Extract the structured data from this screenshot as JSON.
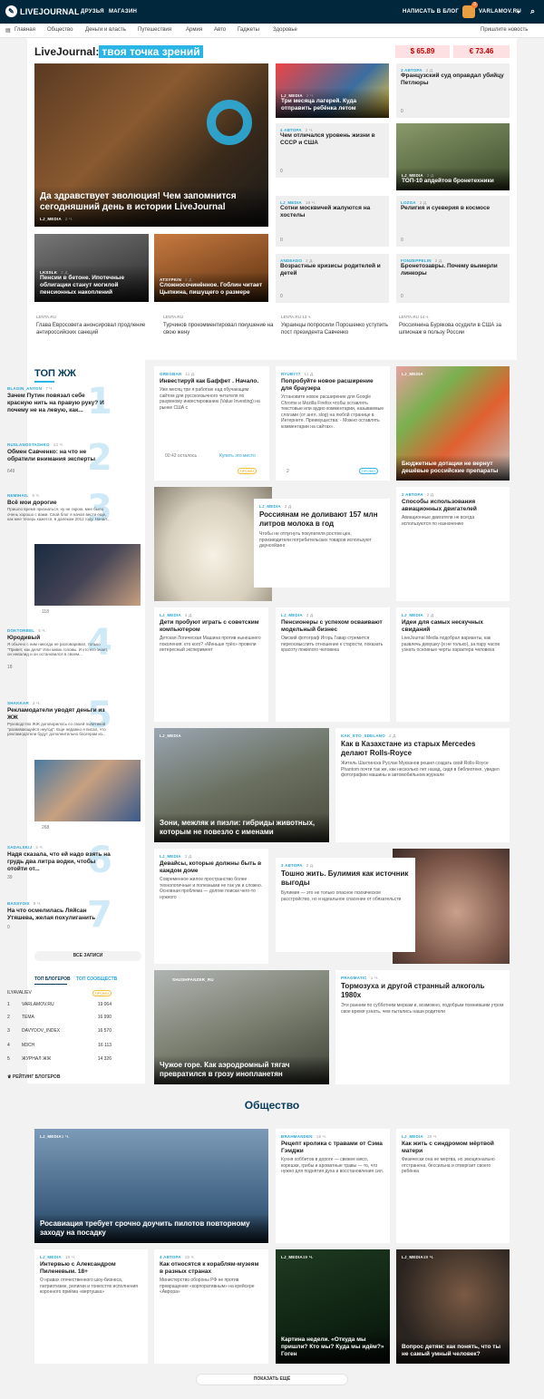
{
  "header": {
    "logo": "LIVEJOURNAL",
    "nav": [
      "ДРУЗЬЯ",
      "МАГАЗИН"
    ],
    "write": "НАПИСАТЬ В БЛОГ",
    "user": "VARLAMOV.RU",
    "badge": "3"
  },
  "subnav": {
    "items": [
      "Главная",
      "Общество",
      "Деньги и власть",
      "Путешествия",
      "Армия",
      "Авто",
      "Гаджеты",
      "Здоровье"
    ],
    "suggest": "Пришлите новость"
  },
  "hero": {
    "title_a": "LiveJournal:",
    "title_b": "твоя точка зрений",
    "usd": "$ 65.89",
    "eur": "€ 73.46",
    "main": {
      "title": "Да здравствует эволюция! Чем запомнится сегодняшний день в истории LiveJournal",
      "author": "LJ_MEDIA",
      "time": "2 ч.",
      "c": "0"
    },
    "small": [
      {
        "author": "LKSSLK",
        "time": "2 д.",
        "title": "Пенсии в бетоне. Ипотечные облигации станут могилой пенсионных накоплений",
        "c": "0"
      },
      {
        "author": "ATSYPKIN",
        "time": "2 д.",
        "title": "Сложносочинённое. Гоблин читает Цыпкина, пишущего о размере",
        "c": "0"
      }
    ],
    "grid": [
      {
        "author": "LJ_MEDIA",
        "time": "2 ч.",
        "title": "Три месяца лагерей. Куда отправить ребёнка летом",
        "c": "0"
      },
      {
        "author": "3 АВТОРА",
        "time": "2 д.",
        "title": "Французский суд оправдал убийцу Петлюры",
        "c": "0"
      },
      {
        "author": "4 АВТОРА",
        "time": "2 ч.",
        "title": "Чем отличался уровень жизни в СССР и США",
        "c": "0"
      },
      {
        "author": "LJ_MEDIA",
        "time": "2 д.",
        "title": "ТОП-10 апдейтов бронетехники",
        "c": "0"
      },
      {
        "author": "LJ_MEDIA",
        "time": "19 ч.",
        "title": "Сотни москвичей жалуются на хостелы",
        "c": "0"
      },
      {
        "author": "LOZGA",
        "time": "2 д.",
        "title": "Религия и суеверия в космосе",
        "c": "0"
      },
      {
        "author": "ANDEADO",
        "time": "2 д.",
        "title": "Возрастные кризисы родителей и детей",
        "c": "0"
      },
      {
        "author": "FONZEPPELIN",
        "time": "2 д.",
        "title": "Бронетозавры. Почему вымерли линкоры",
        "c": "0"
      }
    ],
    "news": [
      {
        "src": "LENTA.RU",
        "t": "",
        "title": "Глава Евросовета анонсировал продление антироссийских санкций"
      },
      {
        "src": "LENTA.RU",
        "t": "",
        "title": "Турчинов прокомментировал покушение на свою жену"
      },
      {
        "src": "LENTA.RU",
        "t": "13 ч.",
        "title": "Украинцы попросили Порошенко уступить пост президента Савченко"
      },
      {
        "src": "LENTA.RU",
        "t": "14 ч.",
        "title": "Россиянина Бурякова осудили в США за шпионаж в пользу России"
      }
    ]
  },
  "top": {
    "title": "ТОП ЖЖ",
    "items": [
      {
        "n": "1",
        "author": "BLAGIN_ANTON",
        "time": "7 ч.",
        "title": "Зачем Путин повязал себе красную нить на правую руку? И почему не на левую, как...",
        "c": "0"
      },
      {
        "n": "2",
        "author": "RUSLANOSTASHKO",
        "time": "13 ч.",
        "title": "Обмен Савченко: на что не обратили внимания эксперты",
        "c": "649"
      },
      {
        "n": "3",
        "author": "NEMIHAIL",
        "time": "9 ч.",
        "title": "Всё мои дорогие",
        "text": "Пришло время признаться, ну не скрою, мне было очень хорошо с вами. Свой блог я начал вести еще, как мне теперь кажется, в далеком 2012 году. Начал...",
        "c": "118"
      },
      {
        "n": "4",
        "author": "DOKTORBEL",
        "time": "5 ч.",
        "title": "Юродивый",
        "text": "Я обычно с ним никогда не разговаривал, только \"Привет, как дела\" Или кивок головы. И кто его знает, он инвалид и он остановился в своем...",
        "c": "18"
      },
      {
        "n": "5",
        "author": "SHAKKAR",
        "time": "3 ч.",
        "title": "Рекламодатели уводят деньги из ЖЖ",
        "text": "Руководство ЖЖ договорилось со своей политикой \"развивающейся неугод\". Еще недавно я писал, что рекламодатели будут дополнительно блогерам из...",
        "c": "268"
      },
      {
        "n": "6",
        "author": "SADALSKIJ",
        "time": "2 ч.",
        "title": "Надя сказала, что ей надо взять на грудь два литра водки, чтобы отойти от...",
        "c": "39"
      },
      {
        "n": "7",
        "author": "BASSYOIX",
        "time": "8 ч.",
        "title": "На что осмелилась Ляйсан Утяшева, желая похулиганить",
        "c": "0"
      }
    ],
    "all": "ВСЕ ЗАПИСИ",
    "tabs": [
      "ТОП БЛОГЕРОВ",
      "ТОП СООБЩЕСТВ"
    ],
    "me": "ILYAVALIEV",
    "promo": "ПРОМО",
    "bloggers": [
      {
        "n": "1",
        "name": "VARLAMOV.RU",
        "v": "19 064"
      },
      {
        "n": "2",
        "name": "TEMA",
        "v": "16 990"
      },
      {
        "n": "3",
        "name": "DAVYDOV_INDEX",
        "v": "16 570"
      },
      {
        "n": "4",
        "name": "M3CH",
        "v": "16 113"
      },
      {
        "n": "5",
        "name": "ЖУРНАЛ ЖЖ",
        "v": "14 326"
      }
    ],
    "rating": "РЕЙТИНГ БЛОГЕРОВ"
  },
  "feed": [
    {
      "author": "GREGBAR",
      "time": "11 д.",
      "title": "Инвестируй как Баффет . Начало.",
      "text": "Уже месяц три я работаю над обучающим сайтом для русскоязычного читателя по разумному инвестированию (Value Investing) на рынке США с",
      "left": "00:42 осталось",
      "buy": "Купить это место",
      "promo": "ПРОМО"
    },
    {
      "author": "RYUB777",
      "time": "11 д.",
      "title": "Попробуйте новое расширение для браузера",
      "text": "Установите новое расширение для Google Chrome и Mozilla Firefox чтобы оставлять текстовые или аудио комментарии, называемые слогами (от англ. slog) на любой странице в Интернете. Преимущества: - Можно оставлять комментарии на сайтах».",
      "c": "2",
      "promo": "ПРОМО"
    },
    {
      "author": "LJ_MEDIA",
      "time": "",
      "title": "Бюджетные дотации не вернут дешёвые российские препараты",
      "c": "0"
    },
    {
      "author": "LJ_MEDIA",
      "time": "2 д.",
      "title": "Россиянам не доливают 157 млн литров молока в год",
      "text": "Чтобы не отпугнуть покупателя ростом цен, производители потребительских товаров используют даунсейзинг",
      "c": "0"
    },
    {
      "author": "2 АВТОРА",
      "time": "2 д.",
      "title": "Способы использования авиационных двигателей",
      "text": "Авиационные двигатели не всегда используются по назначению",
      "c": "0"
    },
    {
      "author": "LJ_MEDIA",
      "time": "2 д.",
      "title": "Дети пробуют играть с советским компьютером",
      "text": "Детская Логическая Машина против нынешнего поколения: кто кого? «Меньше трёх» провели интересный эксперимент",
      "c": "0"
    },
    {
      "author": "LJ_MEDIA",
      "time": "2 д.",
      "title": "Пенсионеры с успехом осваивают модельный бизнес",
      "text": "Омский фотограф Игорь Гавар стремится переосмыслить отношение к старости, показать красоту пожилого человека",
      "c": "0"
    },
    {
      "author": "LJ_MEDIA",
      "time": "2 д.",
      "title": "Идеи для самых нескучных свиданий",
      "text": "LiveJournal Media подобрал варианты, как развлечь девушку (и не только), за пару часов узнать основные черты характера человека",
      "c": "0"
    },
    {
      "author": "LJ_MEDIA",
      "time": "2 д.",
      "title": "Зони, межляк и пизли: гибриды животных, которым не повезло с именами",
      "c": "0"
    },
    {
      "author": "KAK_ETO_SDELANO",
      "time": "2 д.",
      "title": "Как в Казахстане из старых Mercedes делают Rolls-Royce",
      "text": "Житель Шахтинска Руслан Мукханов решил создать свой Rolls-Royce Phantom почти так же, как несколько лет назад, сидя в библиотеке, увидел фотографию машины в автомобильном журнале",
      "c": "0"
    },
    {
      "author": "LJ_MEDIA",
      "time": "2 д.",
      "title": "Девайсы, которые должны быть в каждом доме",
      "text": "Современное жилое пространство более технологичные и полезными не так уж и сложно. Основная проблема — долгие поиски чего-то нужного",
      "c": "0"
    },
    {
      "author": "3 АВТОРА",
      "time": "2 д.",
      "title": "Тошно жить. Булимия как источник выгоды",
      "text": "Булимия — это не только опасное психическое расстройство, но и идеальное спасение от обязательств",
      "c": "0"
    },
    {
      "author": "SHUSHPANZER_RU",
      "time": "2 д.",
      "title": "Чужое горе. Как аэродромный тягач превратился в грозу инопланетян",
      "c": "0"
    },
    {
      "author": "PRAGMATIC",
      "time": "1 ч.",
      "title": "Тормозуха и другой странный алкоголь 1980х",
      "text": "Эти ранним по субботним меркам и, возможно, подобрым помнившим утром свое время узнать, чем пытались наши родители",
      "c": "0"
    }
  ],
  "society": {
    "title": "Общество",
    "items": [
      {
        "author": "LJ_MEDIA",
        "time": "1 ч.",
        "title": "Росавиация требует срочно доучить пилотов повторному заходу на посадку",
        "c": "0",
        "s": "2"
      },
      {
        "author": "BRAHMANDEN",
        "time": "19 ч.",
        "title": "Рецепт кролика с травами от Сэма Гэмджи",
        "text": "Кухня хоббитов в дороге — свежее мясо, корешки, грибы и ароматные травы — то, что нужно для поднятия духа и восстановления сил.",
        "c": "0"
      },
      {
        "author": "LJ_MEDIA",
        "time": "19 ч.",
        "title": "Как жить с синдромом мёртвой матери",
        "text": "Физически она не мертва, но эмоционально отстранена, бессильна и отвергает своего ребёнка",
        "c": "0"
      },
      {
        "author": "LJ_MEDIA",
        "time": "19 ч.",
        "title": "Интервью с Александром Пиленевым. 18+",
        "text": "О нравах отечественного шоу-бизнеса, патриотизме, религии и тонкостях исполнения коронного приёма «вертушка»",
        "c": "0"
      },
      {
        "author": "4 АВТОРА",
        "time": "19 ч.",
        "title": "Как относятся к кораблям-музеям в разных странах",
        "text": "Министерство обороны РФ не против превращения «корпоративным» на крейсере «Аврора»",
        "c": "0"
      },
      {
        "author": "LJ_MEDIA",
        "time": "19 ч.",
        "title": "Картина недели. «Откуда мы пришли? Кто мы? Куда мы идём?» Гоген",
        "c": "0"
      },
      {
        "author": "LJ_MEDIA",
        "time": "19 ч.",
        "title": "Вопрос детям: как понять, что ты не самый умный человек?",
        "c": "0"
      }
    ],
    "more": "ПОКАЗАТЬ ЕЩЁ"
  },
  "colors": {
    "accent": "#2ab5e6",
    "topbar": "#00273c",
    "usd_bg": "#fde1e2",
    "usd_fg": "#c20000"
  }
}
